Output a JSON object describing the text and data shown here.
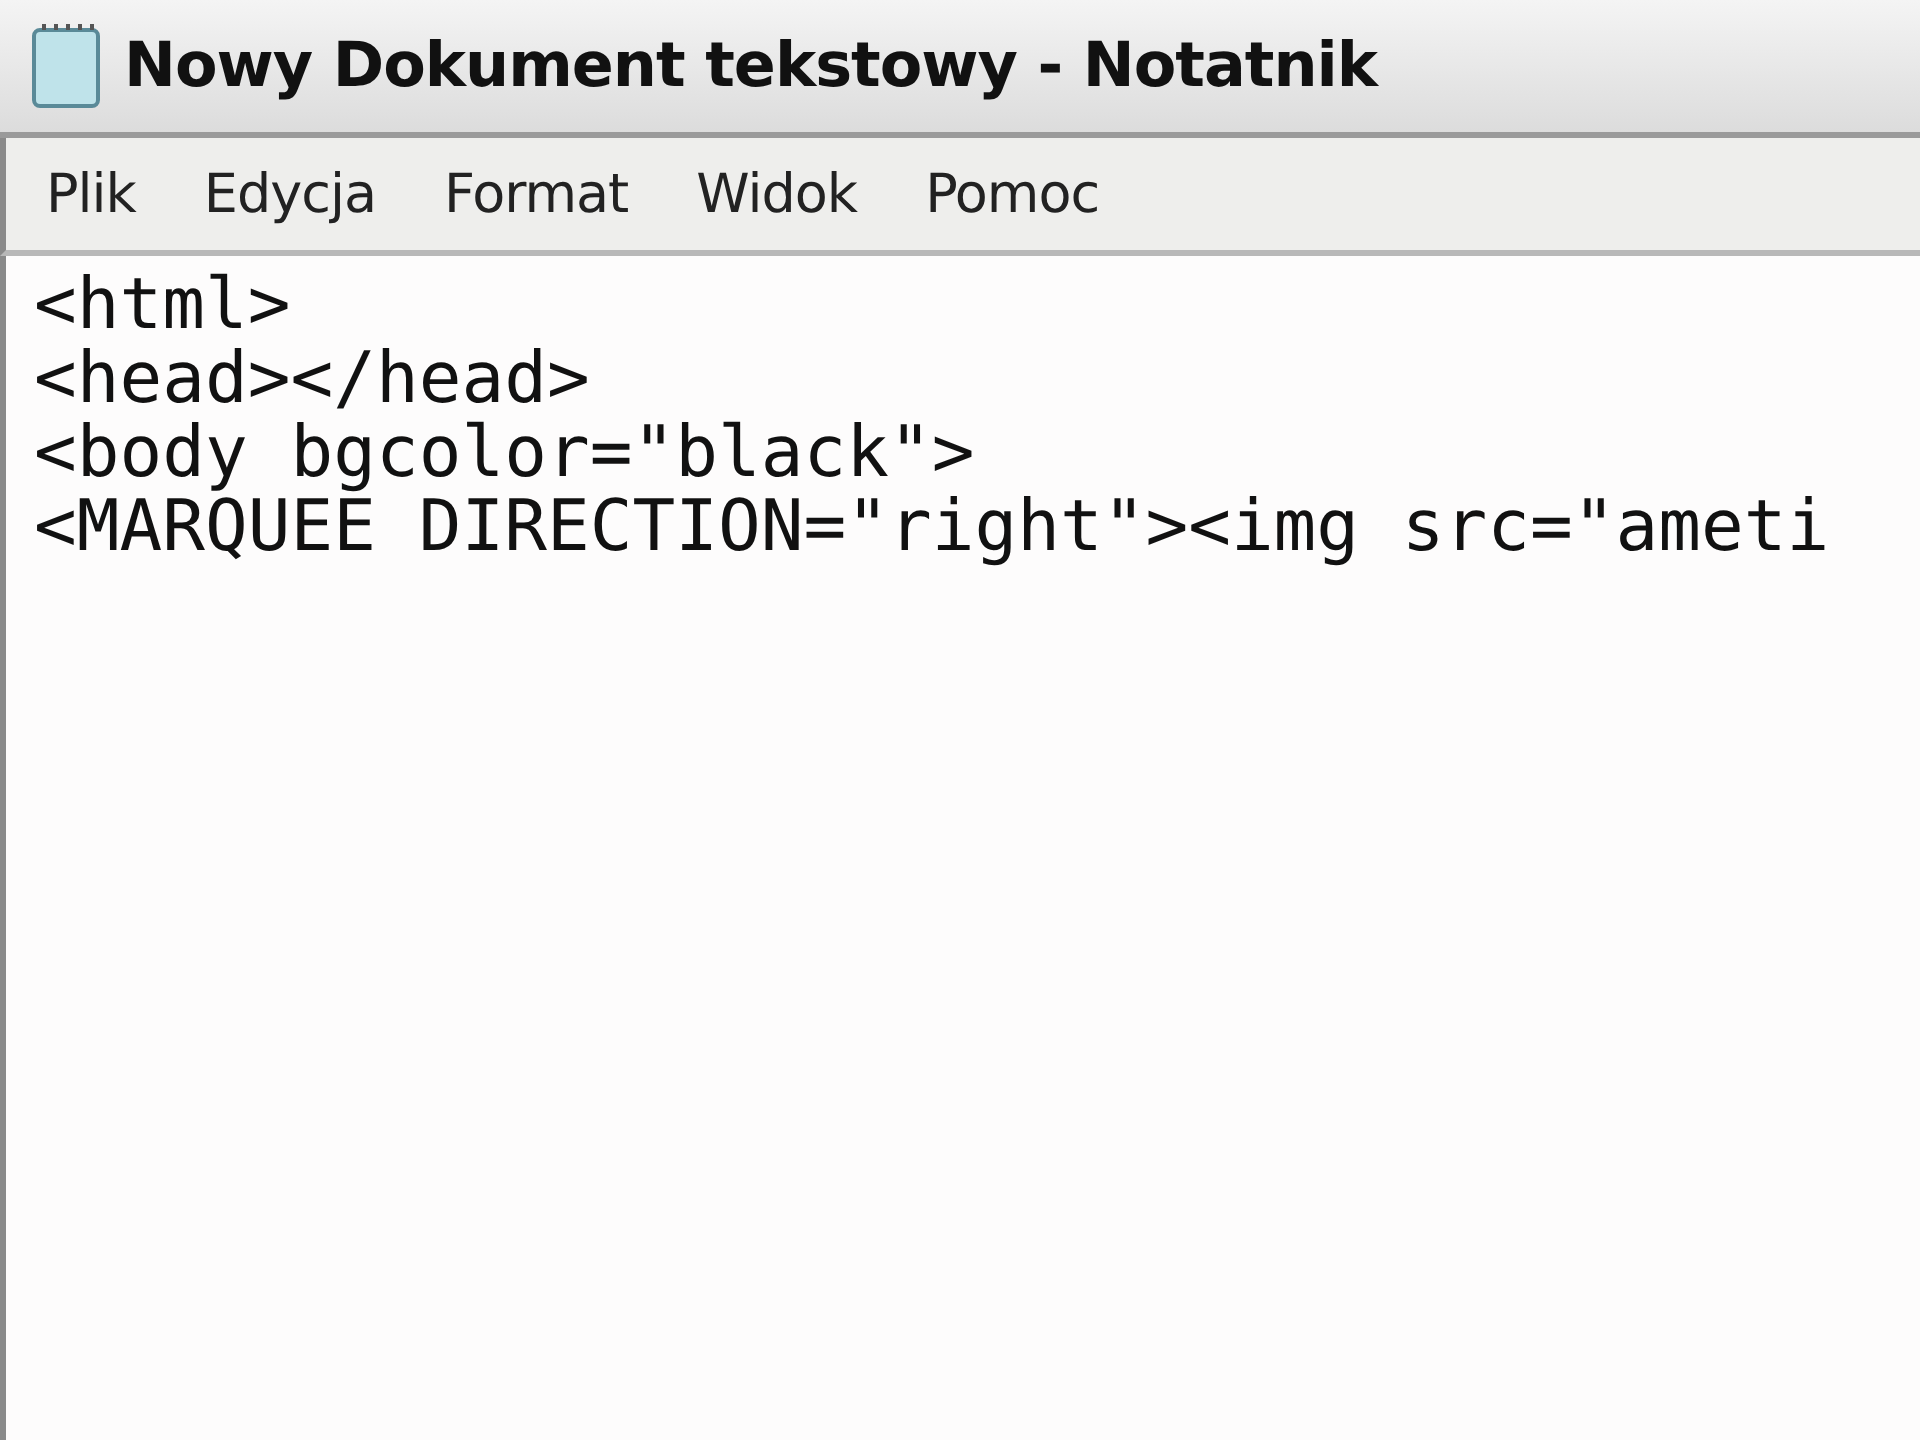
{
  "window": {
    "title": "Nowy Dokument tekstowy - Notatnik"
  },
  "menu": [
    {
      "label": "Plik"
    },
    {
      "label": "Edycja"
    },
    {
      "label": "Format"
    },
    {
      "label": "Widok"
    },
    {
      "label": "Pomoc"
    }
  ],
  "editor": {
    "lines": [
      "<html>",
      "<head></head>",
      "<body bgcolor=\"black\">",
      "<MARQUEE DIRECTION=\"right\"><img src=\"ameti"
    ]
  }
}
